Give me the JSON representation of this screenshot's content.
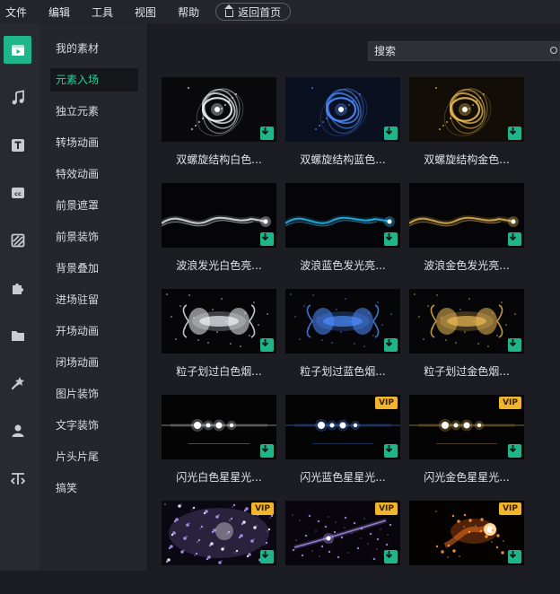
{
  "menu": [
    "文件",
    "编辑",
    "工具",
    "视图",
    "帮助"
  ],
  "home_button": "返回首页",
  "sidebar_icons": [
    "media-icon",
    "music-icon",
    "text-icon",
    "caption-icon",
    "filter-icon",
    "plugin-icon",
    "folder-icon",
    "effects-icon",
    "person-icon",
    "split-icon"
  ],
  "categories": [
    "我的素材",
    "元素入场",
    "独立元素",
    "转场动画",
    "特效动画",
    "前景遮罩",
    "前景装饰",
    "背景叠加",
    "进场驻留",
    "开场动画",
    "闭场动画",
    "图片装饰",
    "文字装饰",
    "片头片尾",
    "搞笑"
  ],
  "active_category": "元素入场",
  "search": {
    "placeholder": "搜索"
  },
  "colors": {
    "accent": "#1fb58a",
    "vip": "#f0b52a",
    "white": "#e8ecf2",
    "blue": "#4d8dff",
    "gold": "#e8b650"
  },
  "items": [
    {
      "label": "双螺旋结构白色...",
      "style": "spiral",
      "tint": "white",
      "vip": false
    },
    {
      "label": "双螺旋结构蓝色...",
      "style": "spiral",
      "tint": "blue",
      "vip": false
    },
    {
      "label": "双螺旋结构金色...",
      "style": "spiral",
      "tint": "gold",
      "vip": false
    },
    {
      "label": "波浪发光白色亮...",
      "style": "wave",
      "tint": "white",
      "vip": false
    },
    {
      "label": "波浪蓝色发光亮...",
      "style": "wave",
      "tint": "cyan",
      "vip": false
    },
    {
      "label": "波浪金色发光亮...",
      "style": "wave",
      "tint": "gold",
      "vip": false
    },
    {
      "label": "粒子划过白色烟...",
      "style": "smoke",
      "tint": "white",
      "vip": false
    },
    {
      "label": "粒子划过蓝色烟...",
      "style": "smoke",
      "tint": "blue",
      "vip": false
    },
    {
      "label": "粒子划过金色烟...",
      "style": "smoke",
      "tint": "gold",
      "vip": false
    },
    {
      "label": "闪光白色星星光...",
      "style": "flash",
      "tint": "white",
      "vip": false
    },
    {
      "label": "闪光蓝色星星光...",
      "style": "flash",
      "tint": "blue",
      "vip": true
    },
    {
      "label": "闪光金色星星光...",
      "style": "flash",
      "tint": "gold",
      "vip": true
    },
    {
      "label": "",
      "style": "burst",
      "tint": "purple",
      "vip": true
    },
    {
      "label": "",
      "style": "comet",
      "tint": "purple",
      "vip": true
    },
    {
      "label": "",
      "style": "fire",
      "tint": "orange",
      "vip": true
    }
  ],
  "vip_label": "VIP"
}
